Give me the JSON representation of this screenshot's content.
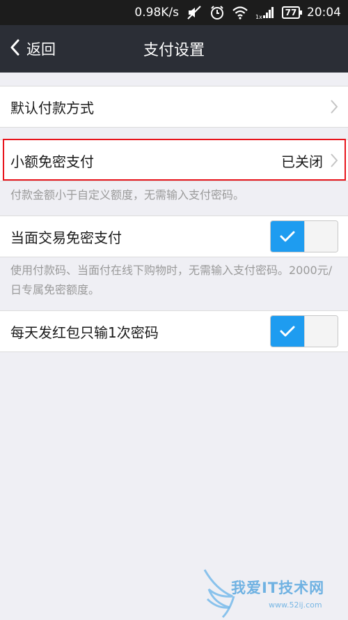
{
  "status_bar": {
    "speed": "0.98K/s",
    "battery": "77",
    "time": "20:04",
    "icons": [
      "mute-icon",
      "alarm-icon",
      "wifi-icon",
      "signal-icon",
      "battery-icon"
    ]
  },
  "nav": {
    "back_label": "返回",
    "title": "支付设置"
  },
  "rows": {
    "default_payment": {
      "label": "默认付款方式"
    },
    "small_amount": {
      "label": "小额免密支付",
      "value": "已关闭"
    },
    "small_amount_hint": "付款金额小于自定义额度，无需输入支付密码。",
    "face_to_face": {
      "label": "当面交易免密支付",
      "toggle_on": true
    },
    "face_to_face_hint": "使用付款码、当面付在线下购物时，无需输入支付密码。2000元/日专属免密额度。",
    "red_packet": {
      "label": "每天发红包只输1次密码",
      "toggle_on": true
    }
  },
  "colors": {
    "navbar": "#2b2e36",
    "toggle_on": "#1e9cf0",
    "highlight": "#e8141c",
    "background": "#efeff4"
  },
  "watermark": {
    "text": "我爱IT技术网",
    "url": "www.52ij.com"
  }
}
